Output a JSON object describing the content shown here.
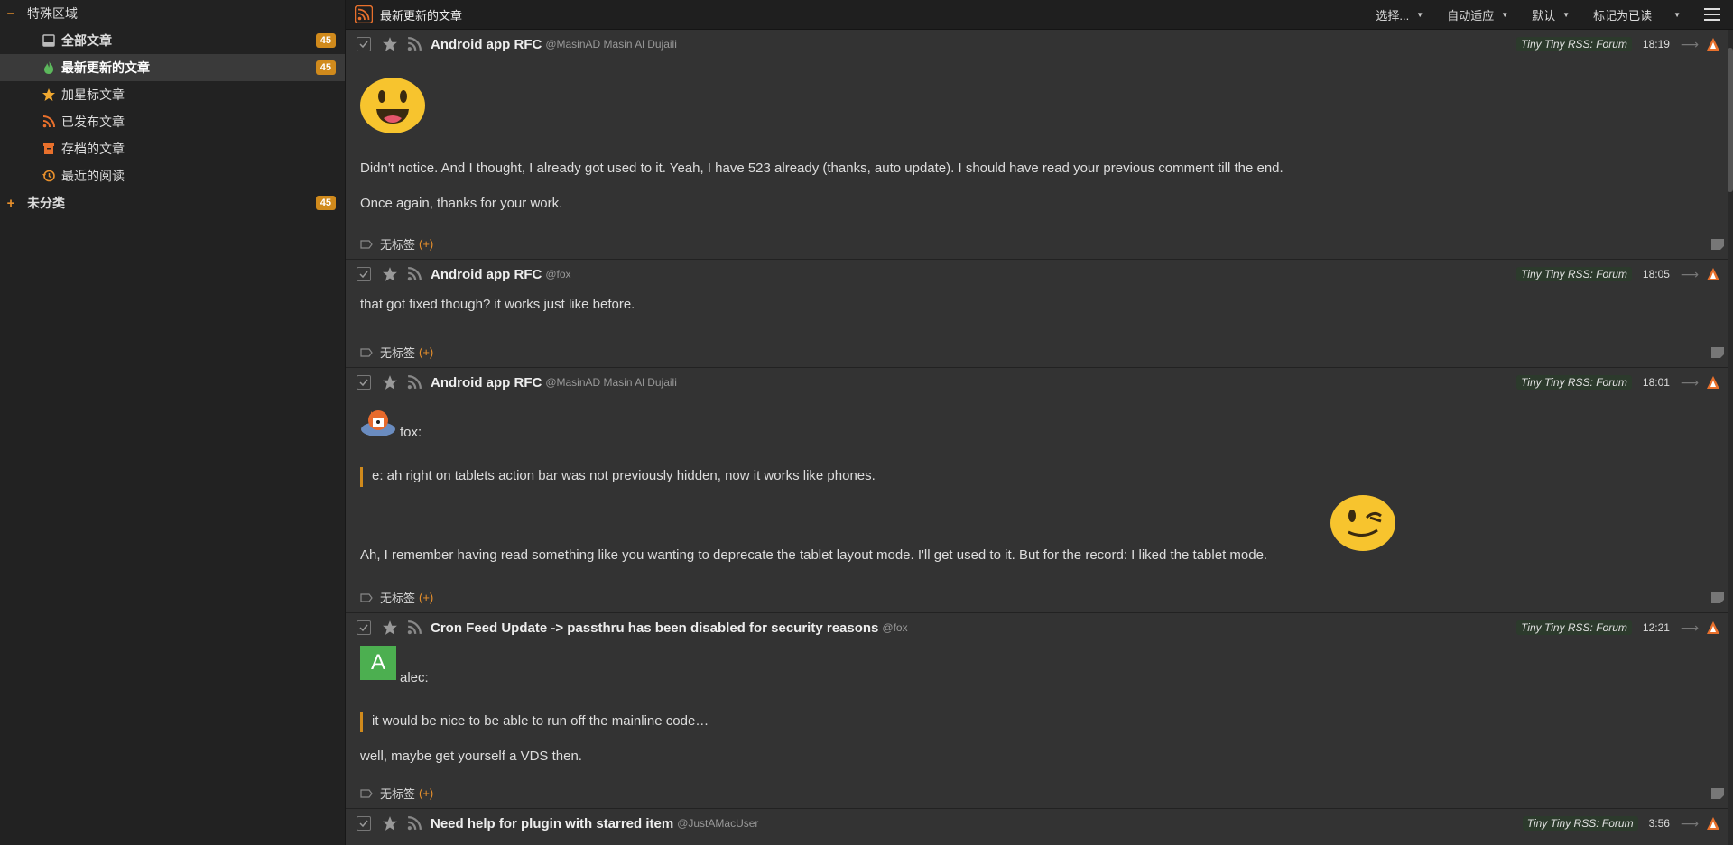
{
  "sidebar": {
    "special_label": "特殊区域",
    "special_toggle": "−",
    "items": [
      {
        "label": "全部文章",
        "count": "45",
        "icon": "archive-icon"
      },
      {
        "label": "最新更新的文章",
        "count": "45",
        "icon": "fire-icon",
        "selected": true
      },
      {
        "label": "加星标文章",
        "icon": "star-icon"
      },
      {
        "label": "已发布文章",
        "icon": "rss-icon"
      },
      {
        "label": "存档的文章",
        "icon": "box-icon"
      },
      {
        "label": "最近的阅读",
        "icon": "history-icon"
      }
    ],
    "uncat_toggle": "+",
    "uncat_label": "未分类",
    "uncat_count": "45"
  },
  "header": {
    "title": "最新更新的文章",
    "select_label": "选择...",
    "view_label": "自动适应",
    "sort_label": "默认",
    "mark_read_label": "标记为已读"
  },
  "articles": [
    {
      "title": "Android app RFC",
      "author": "@MasinAD Masin Al Dujaili",
      "feed": "Tiny Tiny RSS: Forum",
      "time": "18:19",
      "paragraphs": [
        "Didn't notice. And I thought, I already got used to it. Yeah, I have 523 already (thanks, auto update). I should have read your previous comment till the end.",
        "Once again, thanks for your work."
      ],
      "tags": "无标签",
      "tags_add": "(+)"
    },
    {
      "title": "Android app RFC",
      "author": "@fox",
      "feed": "Tiny Tiny RSS: Forum",
      "time": "18:05",
      "paragraphs": [
        "that got fixed though? it works just like before."
      ],
      "tags": "无标签",
      "tags_add": "(+)"
    },
    {
      "title": "Android app RFC",
      "author": "@MasinAD Masin Al Dujaili",
      "feed": "Tiny Tiny RSS: Forum",
      "time": "18:01",
      "quote_author": "fox:",
      "quote": "e: ah right on tablets action bar was not previously hidden, now it works like phones.",
      "paragraphs": [
        "Ah, I remember having read something like you wanting to deprecate the tablet layout mode. I'll get used to it. But for the record: I liked the tablet mode."
      ],
      "tags": "无标签",
      "tags_add": "(+)"
    },
    {
      "title": "Cron Feed Update -> passthru has been disabled for security reasons",
      "author": "@fox",
      "feed": "Tiny Tiny RSS: Forum",
      "time": "12:21",
      "avatar_letter": "A",
      "quote_author": "alec:",
      "quote": "it would be nice to be able to run off the mainline code…",
      "paragraphs": [
        "well, maybe get yourself a VDS then."
      ],
      "tags": "无标签",
      "tags_add": "(+)"
    },
    {
      "title": "Need help for plugin with starred item",
      "author": "@JustAMacUser",
      "feed": "Tiny Tiny RSS: Forum",
      "time": "3:56"
    }
  ],
  "colors": {
    "accent": "#d08a1c",
    "badge_bg": "#2c3a2c"
  }
}
